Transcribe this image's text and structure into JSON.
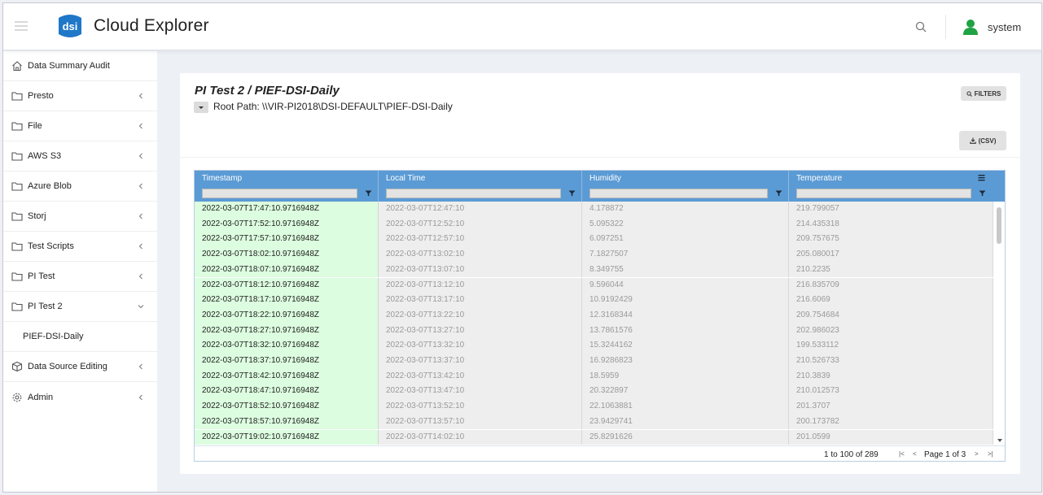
{
  "app": {
    "title": "Cloud Explorer",
    "logo_text": "dsi",
    "user": "system"
  },
  "sidebar": {
    "items": [
      {
        "label": "Data Summary Audit",
        "icon": "home-icon",
        "chevron": ""
      },
      {
        "label": "Presto",
        "icon": "folder-icon",
        "chevron": "left"
      },
      {
        "label": "File",
        "icon": "folder-icon",
        "chevron": "left"
      },
      {
        "label": "AWS S3",
        "icon": "folder-icon",
        "chevron": "left"
      },
      {
        "label": "Azure Blob",
        "icon": "folder-icon",
        "chevron": "left"
      },
      {
        "label": "Storj",
        "icon": "folder-icon",
        "chevron": "left"
      },
      {
        "label": "Test Scripts",
        "icon": "folder-icon",
        "chevron": "left"
      },
      {
        "label": "PI Test",
        "icon": "folder-icon",
        "chevron": "left"
      },
      {
        "label": "PI Test 2",
        "icon": "folder-icon",
        "chevron": "down"
      },
      {
        "label": "PIEF-DSI-Daily",
        "icon": "",
        "chevron": "",
        "sub": true
      },
      {
        "label": "Data Source Editing",
        "icon": "cube-icon",
        "chevron": "left"
      },
      {
        "label": "Admin",
        "icon": "gear-icon",
        "chevron": "left"
      }
    ]
  },
  "main": {
    "title": "PI Test 2 / PIEF-DSI-Daily",
    "root_path": "Root Path: \\\\VIR-PI2018\\DSI-DEFAULT\\PIEF-DSI-Daily",
    "filters_label": "FILTERS",
    "csv_label": "(CSV)"
  },
  "grid": {
    "columns": [
      "Timestamp",
      "Local Time",
      "Humidity",
      "Temperature"
    ],
    "rows": [
      [
        "2022-03-07T17:47:10.9716948Z",
        "2022-03-07T12:47:10",
        "4.178872",
        "219.799057"
      ],
      [
        "2022-03-07T17:52:10.9716948Z",
        "2022-03-07T12:52:10",
        "5.095322",
        "214.435318"
      ],
      [
        "2022-03-07T17:57:10.9716948Z",
        "2022-03-07T12:57:10",
        "6.097251",
        "209.757675"
      ],
      [
        "2022-03-07T18:02:10.9716948Z",
        "2022-03-07T13:02:10",
        "7.1827507",
        "205.080017"
      ],
      [
        "2022-03-07T18:07:10.9716948Z",
        "2022-03-07T13:07:10",
        "8.349755",
        "210.2235"
      ],
      [
        "2022-03-07T18:12:10.9716948Z",
        "2022-03-07T13:12:10",
        "9.596044",
        "216.835709"
      ],
      [
        "2022-03-07T18:17:10.9716948Z",
        "2022-03-07T13:17:10",
        "10.9192429",
        "216.6069"
      ],
      [
        "2022-03-07T18:22:10.9716948Z",
        "2022-03-07T13:22:10",
        "12.3168344",
        "209.754684"
      ],
      [
        "2022-03-07T18:27:10.9716948Z",
        "2022-03-07T13:27:10",
        "13.7861576",
        "202.986023"
      ],
      [
        "2022-03-07T18:32:10.9716948Z",
        "2022-03-07T13:32:10",
        "15.3244162",
        "199.533112"
      ],
      [
        "2022-03-07T18:37:10.9716948Z",
        "2022-03-07T13:37:10",
        "16.9286823",
        "210.526733"
      ],
      [
        "2022-03-07T18:42:10.9716948Z",
        "2022-03-07T13:42:10",
        "18.5959",
        "210.3839"
      ],
      [
        "2022-03-07T18:47:10.9716948Z",
        "2022-03-07T13:47:10",
        "20.322897",
        "210.012573"
      ],
      [
        "2022-03-07T18:52:10.9716948Z",
        "2022-03-07T13:52:10",
        "22.1063881",
        "201.3707"
      ],
      [
        "2022-03-07T18:57:10.9716948Z",
        "2022-03-07T13:57:10",
        "23.9429741",
        "200.173782"
      ],
      [
        "2022-03-07T19:02:10.9716948Z",
        "2022-03-07T14:02:10",
        "25.8291626",
        "201.0599"
      ]
    ],
    "range_text": "1 to 100 of 289",
    "page_text": "Page 1 of 3"
  },
  "colors": {
    "header_blue": "#5b9bd5",
    "timestamp_cell": "#dcfddf",
    "user_icon": "#1fa344",
    "logo": "#1f77c8"
  }
}
